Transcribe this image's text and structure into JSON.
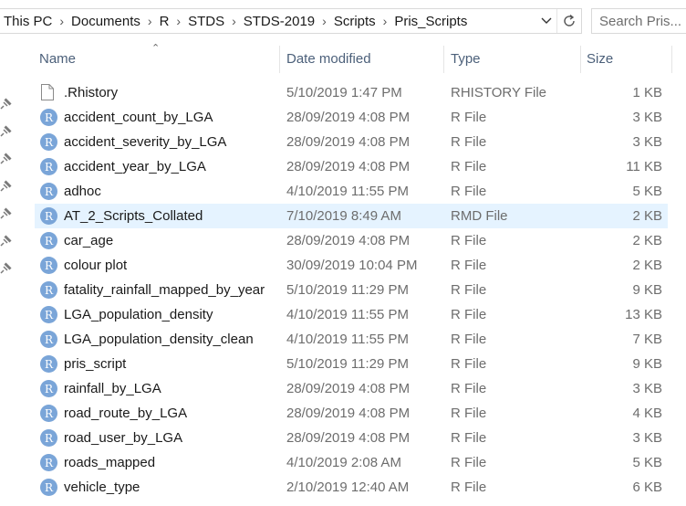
{
  "address": {
    "breadcrumbs": [
      "This PC",
      "Documents",
      "R",
      "STDS",
      "STDS-2019",
      "Scripts",
      "Pris_Scripts"
    ]
  },
  "search": {
    "placeholder": "Search Pris..."
  },
  "columns": {
    "name": "Name",
    "date": "Date modified",
    "type": "Type",
    "size": "Size"
  },
  "files": [
    {
      "name": ".Rhistory",
      "date": "5/10/2019 1:47 PM",
      "type": "RHISTORY File",
      "size": "1 KB",
      "icon": "blank-file-icon"
    },
    {
      "name": "accident_count_by_LGA",
      "date": "28/09/2019 4:08 PM",
      "type": "R File",
      "size": "3 KB",
      "icon": "r-file-icon"
    },
    {
      "name": "accident_severity_by_LGA",
      "date": "28/09/2019 4:08 PM",
      "type": "R File",
      "size": "3 KB",
      "icon": "r-file-icon"
    },
    {
      "name": "accident_year_by_LGA",
      "date": "28/09/2019 4:08 PM",
      "type": "R File",
      "size": "11 KB",
      "icon": "r-file-icon"
    },
    {
      "name": "adhoc",
      "date": "4/10/2019 11:55 PM",
      "type": "R File",
      "size": "5 KB",
      "icon": "r-file-icon"
    },
    {
      "name": "AT_2_Scripts_Collated",
      "date": "7/10/2019 8:49 AM",
      "type": "RMD File",
      "size": "2 KB",
      "icon": "r-file-icon",
      "selected": true
    },
    {
      "name": "car_age",
      "date": "28/09/2019 4:08 PM",
      "type": "R File",
      "size": "2 KB",
      "icon": "r-file-icon"
    },
    {
      "name": "colour plot",
      "date": "30/09/2019 10:04 PM",
      "type": "R File",
      "size": "2 KB",
      "icon": "r-file-icon"
    },
    {
      "name": "fatality_rainfall_mapped_by_year",
      "date": "5/10/2019 11:29 PM",
      "type": "R File",
      "size": "9 KB",
      "icon": "r-file-icon"
    },
    {
      "name": "LGA_population_density",
      "date": "4/10/2019 11:55 PM",
      "type": "R File",
      "size": "13 KB",
      "icon": "r-file-icon"
    },
    {
      "name": "LGA_population_density_clean",
      "date": "4/10/2019 11:55 PM",
      "type": "R File",
      "size": "7 KB",
      "icon": "r-file-icon"
    },
    {
      "name": "pris_script",
      "date": "5/10/2019 11:29 PM",
      "type": "R File",
      "size": "9 KB",
      "icon": "r-file-icon"
    },
    {
      "name": "rainfall_by_LGA",
      "date": "28/09/2019 4:08 PM",
      "type": "R File",
      "size": "3 KB",
      "icon": "r-file-icon"
    },
    {
      "name": "road_route_by_LGA",
      "date": "28/09/2019 4:08 PM",
      "type": "R File",
      "size": "4 KB",
      "icon": "r-file-icon"
    },
    {
      "name": "road_user_by_LGA",
      "date": "28/09/2019 4:08 PM",
      "type": "R File",
      "size": "3 KB",
      "icon": "r-file-icon"
    },
    {
      "name": "roads_mapped",
      "date": "4/10/2019 2:08 AM",
      "type": "R File",
      "size": "5 KB",
      "icon": "r-file-icon"
    },
    {
      "name": "vehicle_type",
      "date": "2/10/2019 12:40 AM",
      "type": "R File",
      "size": "6 KB",
      "icon": "r-file-icon"
    }
  ],
  "colors": {
    "selected_row": "#e5f3ff",
    "header_text": "#4c607a",
    "r_icon": "#7aa5d8"
  }
}
